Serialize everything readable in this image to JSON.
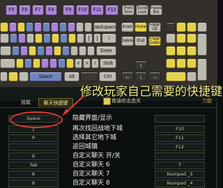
{
  "keyboard": {
    "fn_row": [
      "F5",
      "F6",
      "F7",
      "F8",
      "F9",
      "F10",
      "F11",
      "F12",
      "Print\nScrn",
      "Scroll\nLock",
      "Pause\nBrk"
    ],
    "row2": [
      "",
      "",
      "",
      "",
      "",
      "",
      "",
      "",
      "",
      "",
      "",
      "backspace"
    ],
    "row3": [
      "",
      "",
      "",
      "",
      "",
      "",
      "",
      "",
      "",
      "",
      "[",
      "]",
      "\\"
    ],
    "row4": [
      "",
      "",
      "",
      "",
      "",
      "",
      "",
      "",
      "",
      "",
      "",
      "Enter"
    ],
    "row5": [
      "",
      "",
      "",
      "",
      "",
      "",
      "",
      "",
      "<",
      ">",
      "/",
      "Shift"
    ],
    "row6": [
      "",
      "",
      "",
      "Space",
      "",
      "Alt",
      "",
      "Ctrl"
    ],
    "nav": [
      "Insert",
      "Home",
      "Page\nUp",
      "Delete",
      "End",
      "Page\nDown",
      "↑",
      "←",
      "↓",
      "→"
    ]
  },
  "tabs": [
    "技能",
    "聊天快捷键"
  ],
  "overlay_text": "修改玩家自己需要的快捷键",
  "option_checkbox_label": "普通攻击选关",
  "right_caption": "力能",
  "bindings": [
    {
      "left": "Space",
      "label": "隐藏界面/显示",
      "right": ""
    },
    {
      "left": "J",
      "label": "再次找回战地下城",
      "right": "F10"
    },
    {
      "left": "P",
      "label": "选择其它地下城",
      "right": "F11"
    },
    {
      "left": "",
      "label": "返回城镇",
      "right": "F12"
    },
    {
      "left": "G",
      "label": "自定义聊天 开/关",
      "right": ""
    },
    {
      "left": "Tab",
      "label": "自定义聊天 6",
      "right": "T"
    },
    {
      "left": "8",
      "label": "自定义聊天 7",
      "right": "Numpad _3"
    },
    {
      "left": "9",
      "label": "自定义聊天 8",
      "right": "Numpad _4"
    }
  ],
  "colors": {
    "accent_yellow": "#e6d24a",
    "highlight_red": "#e13b2c",
    "key_purple": "#a883d6",
    "key_blue": "#6f85bb"
  }
}
